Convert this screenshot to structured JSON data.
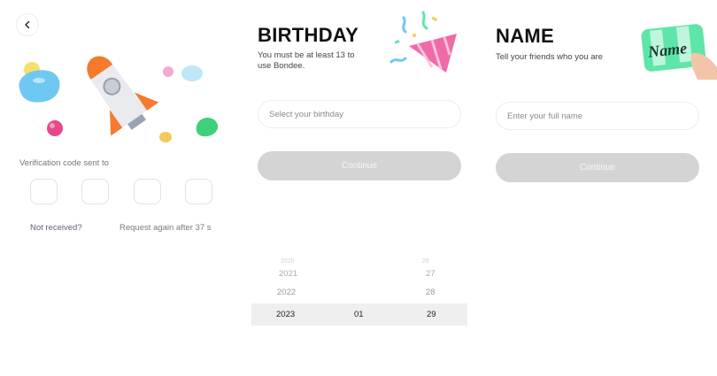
{
  "verify": {
    "sent_label": "Verification code sent to",
    "not_received": "Not received?",
    "request_again": "Request again after 37 s",
    "code_digits": [
      "",
      "",
      "",
      ""
    ]
  },
  "birthday": {
    "title": "BIRTHDAY",
    "subtitle_line1": "You must be at least 13 to",
    "subtitle_line2": "use Bondee.",
    "placeholder": "Select your birthday",
    "continue_label": "Continue",
    "picker": {
      "years": [
        "2020",
        "2021",
        "2022",
        "2023"
      ],
      "month": "01",
      "days": [
        "26",
        "27",
        "28",
        "29"
      ],
      "selected": {
        "year": "2023",
        "month": "01",
        "day": "29"
      }
    }
  },
  "name": {
    "title": "NAME",
    "subtitle": "Tell your friends who you are",
    "placeholder": "Enter your full name",
    "continue_label": "Continue",
    "card_text": "Name"
  },
  "colors": {
    "button_disabled": "#d4d4d4",
    "rocket_fin": "#f57a2e",
    "accent_green": "#5ee6a8",
    "accent_pink": "#f06ba6"
  }
}
